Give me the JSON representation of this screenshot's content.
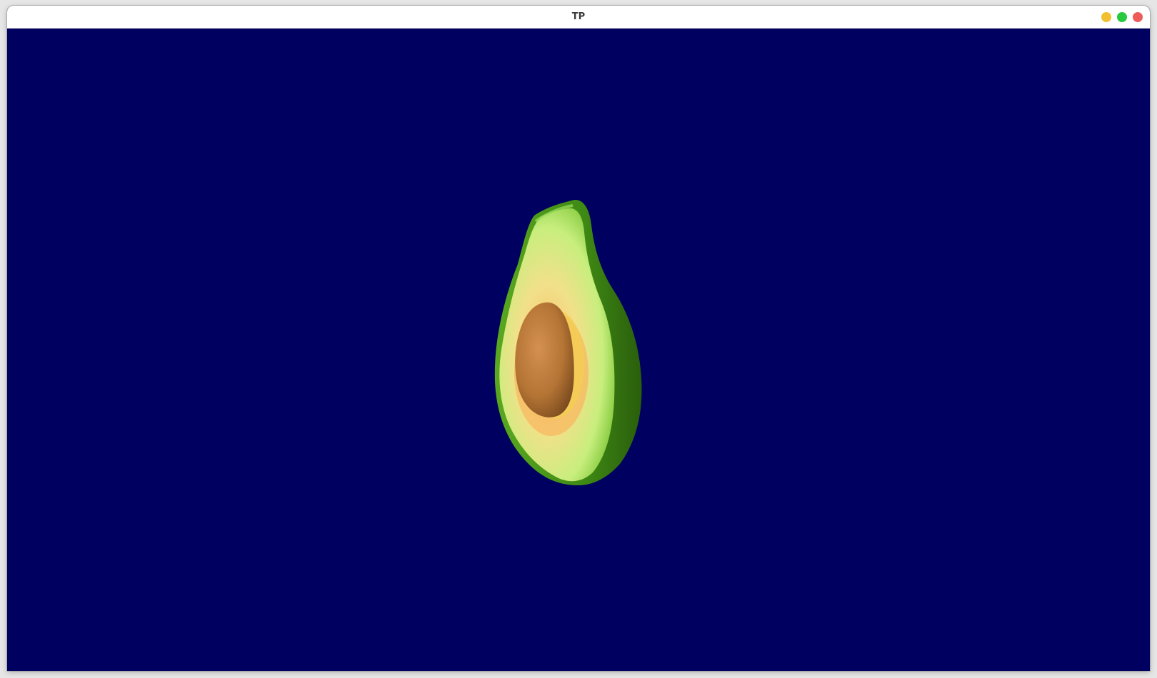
{
  "window": {
    "title": "TP",
    "controls": [
      {
        "name": "minimize",
        "color": "#f0c030"
      },
      {
        "name": "maximize",
        "color": "#27c93f"
      },
      {
        "name": "close",
        "color": "#ee5b5b"
      }
    ]
  },
  "scene": {
    "background_color": "#000060",
    "object": "avocado-half",
    "colors": {
      "skin_dark": "#2f6a10",
      "skin": "#4e9a1a",
      "flesh_light": "#c8f080",
      "flesh_inner": "#f0e890",
      "flesh_orange": "#f7b860",
      "pit": "#b87838",
      "pit_dark": "#7a4a1e"
    }
  }
}
